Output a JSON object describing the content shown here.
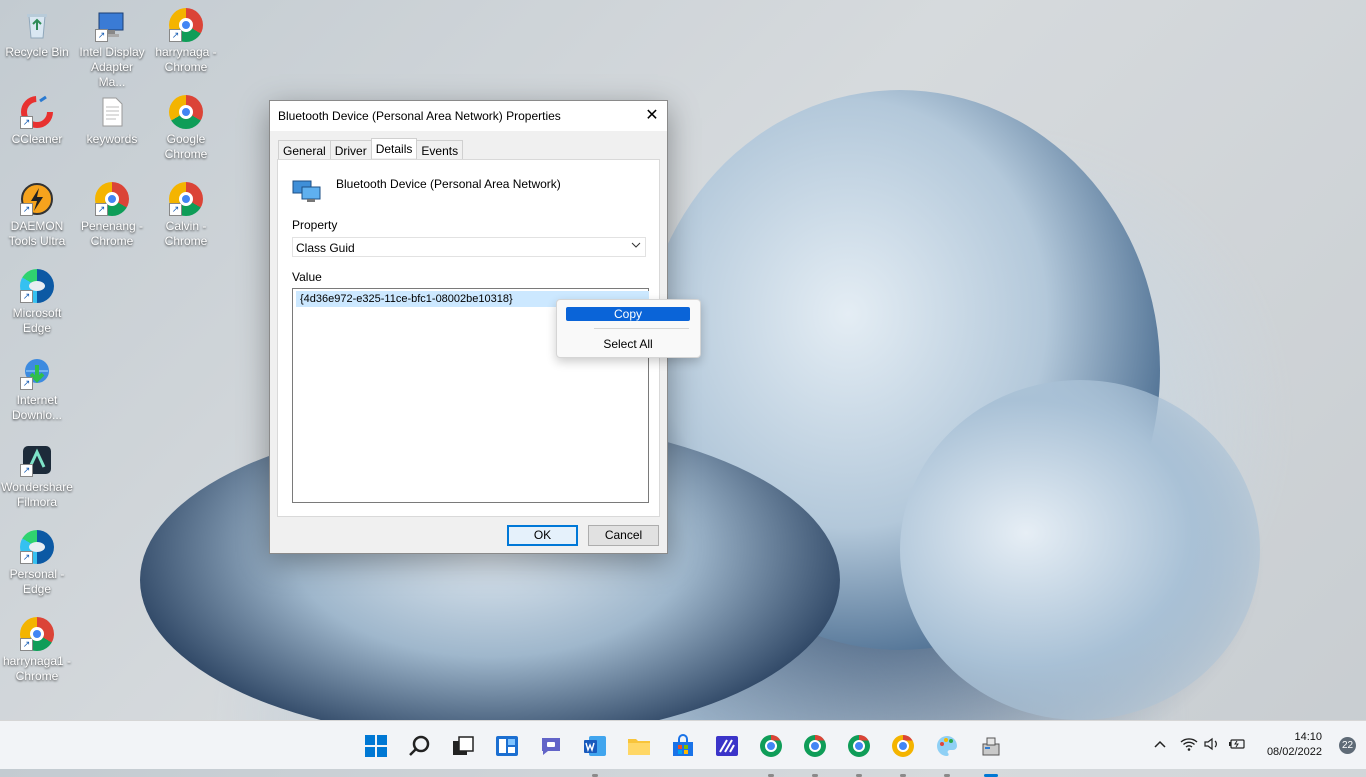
{
  "desktop": {
    "icons": [
      {
        "label": "Recycle Bin",
        "icon": "recycle-bin-icon"
      },
      {
        "label": "Intel Display Adapter Ma...",
        "icon": "display-adapter-icon"
      },
      {
        "label": "harrynaga - Chrome",
        "icon": "chrome-icon"
      },
      {
        "label": "CCleaner",
        "icon": "ccleaner-icon"
      },
      {
        "label": "keywords",
        "icon": "text-document-icon"
      },
      {
        "label": "Google Chrome",
        "icon": "chrome-icon"
      },
      {
        "label": "DAEMON Tools Ultra",
        "icon": "daemon-tools-icon"
      },
      {
        "label": "Penenang - Chrome",
        "icon": "chrome-icon"
      },
      {
        "label": "Calvin - Chrome",
        "icon": "chrome-icon"
      },
      {
        "label": "Microsoft Edge",
        "icon": "edge-icon"
      },
      {
        "label": "Internet Downlo...",
        "icon": "idm-icon"
      },
      {
        "label": "Wondershare Filmora",
        "icon": "filmora-icon"
      },
      {
        "label": "Personal - Edge",
        "icon": "edge-icon"
      },
      {
        "label": "harrynaga1 - Chrome",
        "icon": "chrome-icon"
      }
    ]
  },
  "dialog": {
    "title": "Bluetooth Device (Personal Area Network) Properties",
    "close_glyph": "✕",
    "tabs": [
      "General",
      "Driver",
      "Details",
      "Events"
    ],
    "active_tab": "Details",
    "device_name": "Bluetooth Device (Personal Area Network)",
    "property_label": "Property",
    "property_value": "Class Guid",
    "value_label": "Value",
    "value_entry": "{4d36e972-e325-11ce-bfc1-08002be10318}",
    "ok_label": "OK",
    "cancel_label": "Cancel"
  },
  "context_menu": {
    "items": [
      "Copy",
      "Select All"
    ],
    "highlighted": "Copy"
  },
  "taskbar": {
    "apps": [
      "start-icon",
      "search-icon",
      "task-view-icon",
      "widgets-icon",
      "chat-icon",
      "word-icon",
      "file-explorer-icon",
      "store-icon",
      "mail-app-icon",
      "chrome-profile-icon",
      "chrome-profile-icon",
      "chrome-profile-icon",
      "chrome-icon",
      "paint-icon",
      "device-manager-icon"
    ],
    "time": "14:10",
    "date": "08/02/2022",
    "notification_count": "22",
    "accent": "#0078d4"
  }
}
